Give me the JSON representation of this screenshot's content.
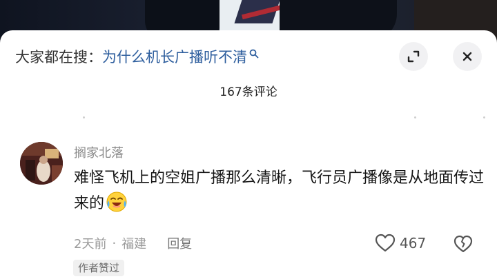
{
  "header": {
    "search_prefix": "大家都在搜：",
    "search_query": "为什么机长广播听不清"
  },
  "comments_count": "167条评论",
  "comment": {
    "username": "搁家北落",
    "text": "难怪飞机上的空姐广播那么清晰，飞行员广播像是从地面传过来的",
    "emoji": "crying-laughing-emoji",
    "time": "2天前",
    "separator": "·",
    "location": "福建",
    "reply_label": "回复",
    "likes": "467",
    "badge": "作者赞过"
  },
  "colors": {
    "query_link": "#2f5f9e",
    "text_primary": "#151515",
    "text_secondary": "#9a9a9a"
  }
}
